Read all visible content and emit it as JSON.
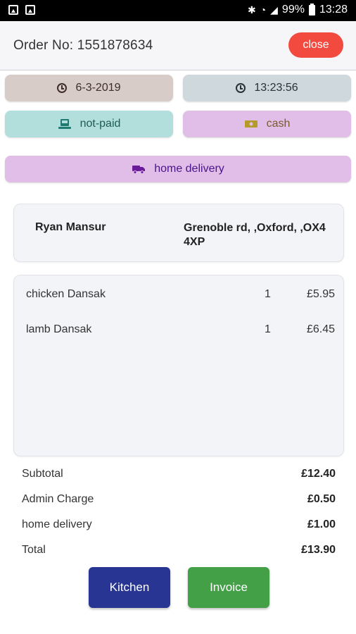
{
  "status_bar": {
    "battery": "99%",
    "time": "13:28",
    "icons": [
      "image-icon",
      "security-icon",
      "bluetooth-icon",
      "wifi-icon",
      "signal-icon",
      "battery-icon"
    ]
  },
  "header": {
    "order_label": "Order No: 1551878634",
    "close_label": "close"
  },
  "chips": {
    "date": "6-3-2019",
    "time": "13:23:56",
    "payment_status": "not-paid",
    "payment_method": "cash",
    "delivery_type": "home delivery"
  },
  "customer": {
    "name": "Ryan Mansur",
    "address": "Grenoble rd, ,Oxford, ,OX4 4XP"
  },
  "items": [
    {
      "name": "chicken Dansak",
      "qty": "1",
      "price": "£5.95"
    },
    {
      "name": "lamb Dansak",
      "qty": "1",
      "price": "£6.45"
    }
  ],
  "totals": [
    {
      "label": "Subtotal",
      "value": "£12.40"
    },
    {
      "label": "Admin Charge",
      "value": "£0.50"
    },
    {
      "label": "home delivery",
      "value": "£1.00"
    },
    {
      "label": "Total",
      "value": "£13.90"
    }
  ],
  "actions": {
    "kitchen": "Kitchen",
    "invoice": "Invoice"
  },
  "colors": {
    "close": "#f24a3f",
    "kitchen": "#283593",
    "invoice": "#43a047",
    "date_chip": "#d7ccc8",
    "time_chip": "#cfd8dc",
    "paid_chip": "#b2dfdb",
    "cash_chip": "#e1bee7",
    "delivery_chip": "#e1bee7"
  }
}
